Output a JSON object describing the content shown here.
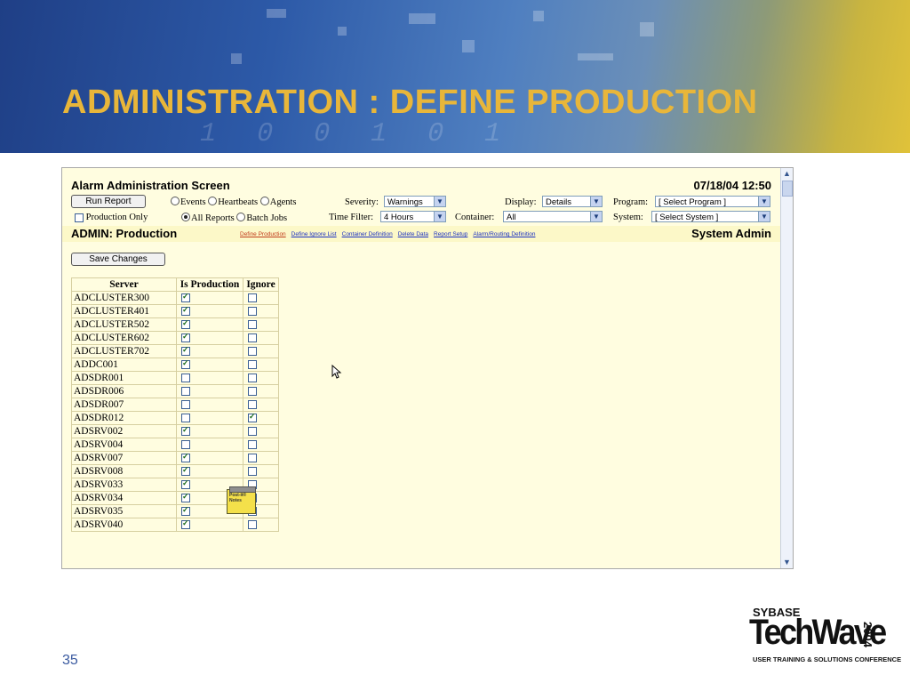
{
  "slide": {
    "title": "ADMINISTRATION : DEFINE PRODUCTION",
    "page_number": "35",
    "banner_digits": "1 0 0 1 0 1"
  },
  "screen": {
    "header_title": "Alarm Administration Screen",
    "datetime": "07/18/04 12:50",
    "run_report_label": "Run Report",
    "report_types": [
      "Events",
      "Heartbeats",
      "Agents"
    ],
    "production_only_label": "Production Only",
    "report_scope": [
      "All Reports",
      "Batch Jobs"
    ],
    "severity_label": "Severity:",
    "severity_value": "Warnings",
    "time_filter_label": "Time Filter:",
    "time_filter_value": "4 Hours",
    "display_label": "Display:",
    "display_value": "Details",
    "container_label": "Container:",
    "container_value": "All",
    "program_label": "Program:",
    "program_value": "[ Select Program ]",
    "system_label": "System:",
    "system_value": "[ Select System ]",
    "admin_title": "ADMIN: Production",
    "role": "System Admin",
    "nav_links": [
      "Define Production",
      "Define Ignore List",
      "Container Definition",
      "Delete Data",
      "Report Setup",
      "Alarm/Routing Definition"
    ],
    "save_label": "Save Changes",
    "columns": [
      "Server",
      "Is Production",
      "Ignore"
    ],
    "rows": [
      {
        "server": "ADCLUSTER300",
        "prod": true,
        "ignore": false
      },
      {
        "server": "ADCLUSTER401",
        "prod": true,
        "ignore": false
      },
      {
        "server": "ADCLUSTER502",
        "prod": true,
        "ignore": false
      },
      {
        "server": "ADCLUSTER602",
        "prod": true,
        "ignore": false
      },
      {
        "server": "ADCLUSTER702",
        "prod": true,
        "ignore": false
      },
      {
        "server": "ADDC001",
        "prod": true,
        "ignore": false
      },
      {
        "server": "ADSDR001",
        "prod": false,
        "ignore": false
      },
      {
        "server": "ADSDR006",
        "prod": false,
        "ignore": false
      },
      {
        "server": "ADSDR007",
        "prod": false,
        "ignore": false
      },
      {
        "server": "ADSDR012",
        "prod": false,
        "ignore": true
      },
      {
        "server": "ADSRV002",
        "prod": true,
        "ignore": false
      },
      {
        "server": "ADSRV004",
        "prod": false,
        "ignore": false
      },
      {
        "server": "ADSRV007",
        "prod": true,
        "ignore": false
      },
      {
        "server": "ADSRV008",
        "prod": true,
        "ignore": false
      },
      {
        "server": "ADSRV033",
        "prod": true,
        "ignore": false
      },
      {
        "server": "ADSRV034",
        "prod": true,
        "ignore": false
      },
      {
        "server": "ADSRV035",
        "prod": true,
        "ignore": false
      },
      {
        "server": "ADSRV040",
        "prod": true,
        "ignore": false
      }
    ],
    "postit_text": "Post-it® Notes"
  },
  "logo": {
    "brand": "SYBASE",
    "name": "TechWave",
    "year": "2004",
    "tagline": "USER TRAINING & SOLUTIONS CONFERENCE"
  }
}
